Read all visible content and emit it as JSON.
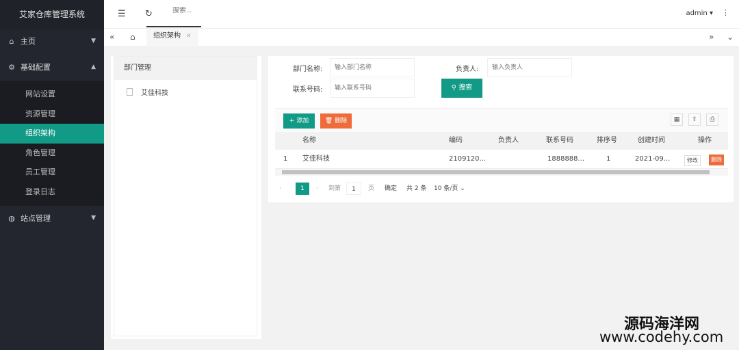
{
  "app": {
    "title": "艾家仓库管理系统"
  },
  "sidebar": {
    "items": [
      {
        "label": "主页",
        "icon": "home-icon"
      },
      {
        "label": "基础配置",
        "icon": "gear-icon"
      },
      {
        "label": "站点管理",
        "icon": "site-icon"
      }
    ],
    "sub_items": [
      "网站设置",
      "资源管理",
      "组织架构",
      "角色管理",
      "员工管理",
      "登录日志"
    ]
  },
  "header": {
    "search_placeholder": "搜索...",
    "user": "admin"
  },
  "tabs": {
    "active": "组织架构"
  },
  "tree": {
    "header": "部门管理",
    "node": "艾佳科技"
  },
  "filters": {
    "dept_label": "部门名称:",
    "dept_placeholder": "输入部门名称",
    "manager_label": "负责人:",
    "manager_placeholder": "输入负责人",
    "phone_label": "联系号码:",
    "phone_placeholder": "输入联系号码",
    "search_button": "搜索"
  },
  "toolbar": {
    "add_label": "添加",
    "delete_label": "删除"
  },
  "table": {
    "columns": [
      "名称",
      "编码",
      "负责人",
      "联系号码",
      "排序号",
      "创建时间",
      "操作"
    ],
    "rows": [
      {
        "index": "1",
        "name": "艾佳科技",
        "code": "2109120...",
        "manager": "",
        "phone": "1888888...",
        "sort": "1",
        "created": "2021-09...",
        "edit": "修改",
        "delete": "删除"
      }
    ]
  },
  "pager": {
    "current": "1",
    "goto_label": "到第",
    "goto_value": "1",
    "page_unit": "页",
    "confirm": "确定",
    "total": "共 2 条",
    "page_size": "10 条/页"
  },
  "watermark": {
    "line1": "源码海洋网",
    "line2": "www.codehy.com"
  },
  "colors": {
    "accent": "#119a86",
    "danger": "#ee6b3b",
    "sidebar": "#23262e"
  }
}
